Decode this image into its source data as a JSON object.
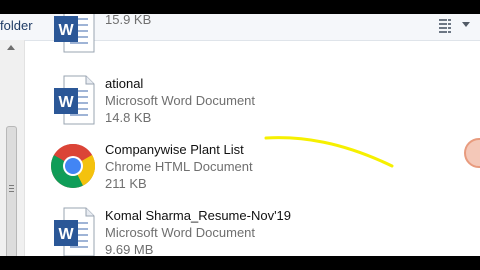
{
  "toolbar": {
    "label": "folder"
  },
  "files": [
    {
      "name": "",
      "type": "",
      "size": "15.9 KB",
      "icon": "word-document-icon"
    },
    {
      "name": "ational",
      "type": "Microsoft Word Document",
      "size": "14.8 KB",
      "icon": "word-document-icon"
    },
    {
      "name": "Companywise Plant List",
      "type": "Chrome HTML Document",
      "size": "211 KB",
      "icon": "chrome-icon"
    },
    {
      "name": "Komal Sharma_Resume-Nov'19",
      "type": "Microsoft Word Document",
      "size": "9.69 MB",
      "icon": "word-document-icon"
    }
  ],
  "colors": {
    "highlight_stroke": "#f6f000",
    "word_blue": "#2b5797",
    "chrome_red": "#db4437",
    "chrome_yellow": "#f4c20d",
    "chrome_green": "#0f9d58",
    "chrome_blue": "#4285f4"
  }
}
